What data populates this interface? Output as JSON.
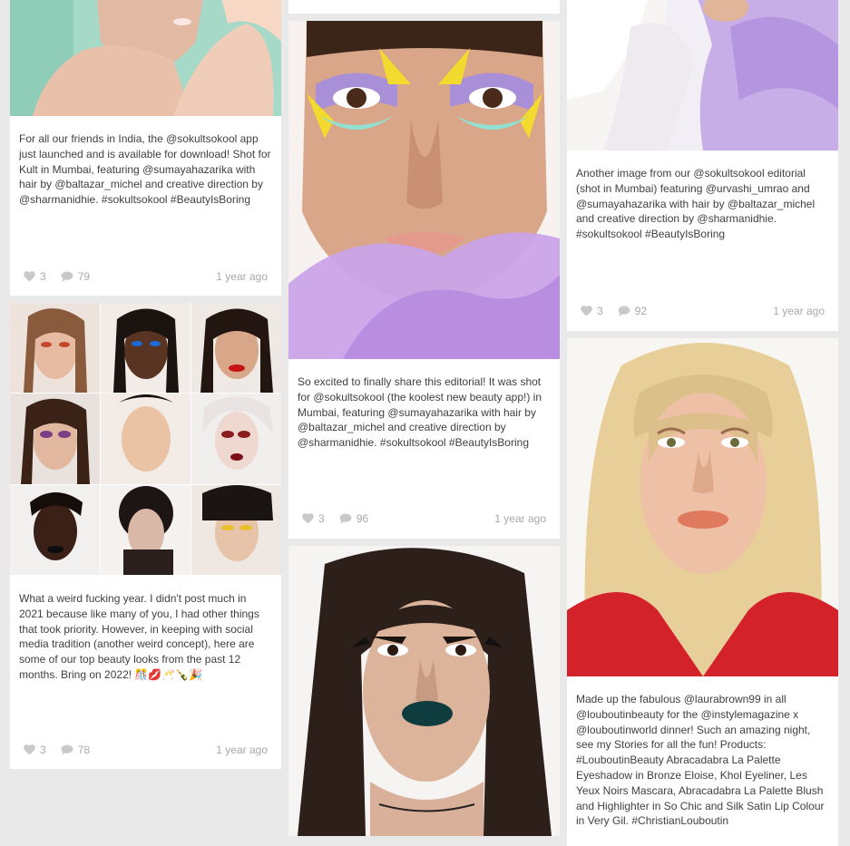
{
  "posts": [
    {
      "caption": "For all our friends in India, the @sokultsokool app just launched and is available for download! Shot for Kult in Mumbai, featuring @sumayahazarika with hair by @baltazar_michel and creative direction by @sharmanidhie. #sokultsokool #BeautyIsBoring",
      "likes": "3",
      "comments": "79",
      "time": "1 year ago"
    },
    {
      "caption": "What a weird fucking year. I didn't post much in 2021 because like many of you, I had other things that took priority. However, in keeping with social media tradition (another weird concept), here are some of our top beauty looks from the past 12 months. Bring on 2022! 🎊💋🥂🍾🎉",
      "likes": "3",
      "comments": "78",
      "time": "1 year ago"
    },
    {
      "caption": "So excited to finally share this editorial! It was shot for @sokultsokool (the koolest new beauty app!) in Mumbai, featuring @sumayahazarika with hair by @baltazar_michel and creative direction by @sharmanidhie. #sokultsokool #BeautyIsBoring",
      "likes": "3",
      "comments": "96",
      "time": "1 year ago"
    },
    {
      "caption": "Another image from our @sokultsokool editorial (shot in Mumbai) featuring @urvashi_umrao and @sumayahazarika with hair by @baltazar_michel and creative direction by @sharmanidhie. #sokultsokool #BeautyIsBoring",
      "likes": "3",
      "comments": "92",
      "time": "1 year ago"
    },
    {
      "caption": "Made up the fabulous @laurabrown99 in all @louboutinbeauty for the @instylemagazine x @louboutinworld dinner! Such an amazing night, see my Stories for all the fun! Products: #LouboutinBeauty Abracadabra La Palette Eyeshadow in Bronze Eloise, Khol Eyeliner, Les Yeux Noirs Mascara, Abracadabra La Palette Blush and Highlighter in So Chic and Silk Satin Lip Colour in Very Gil. #ChristianLouboutin"
    }
  ],
  "icons": {
    "like": "heart-icon",
    "comment": "speech-bubble-icon"
  },
  "colors": {
    "background": "#e9e9e9",
    "card": "#ffffff",
    "text": "#404040",
    "meta": "#a8a8a8"
  }
}
